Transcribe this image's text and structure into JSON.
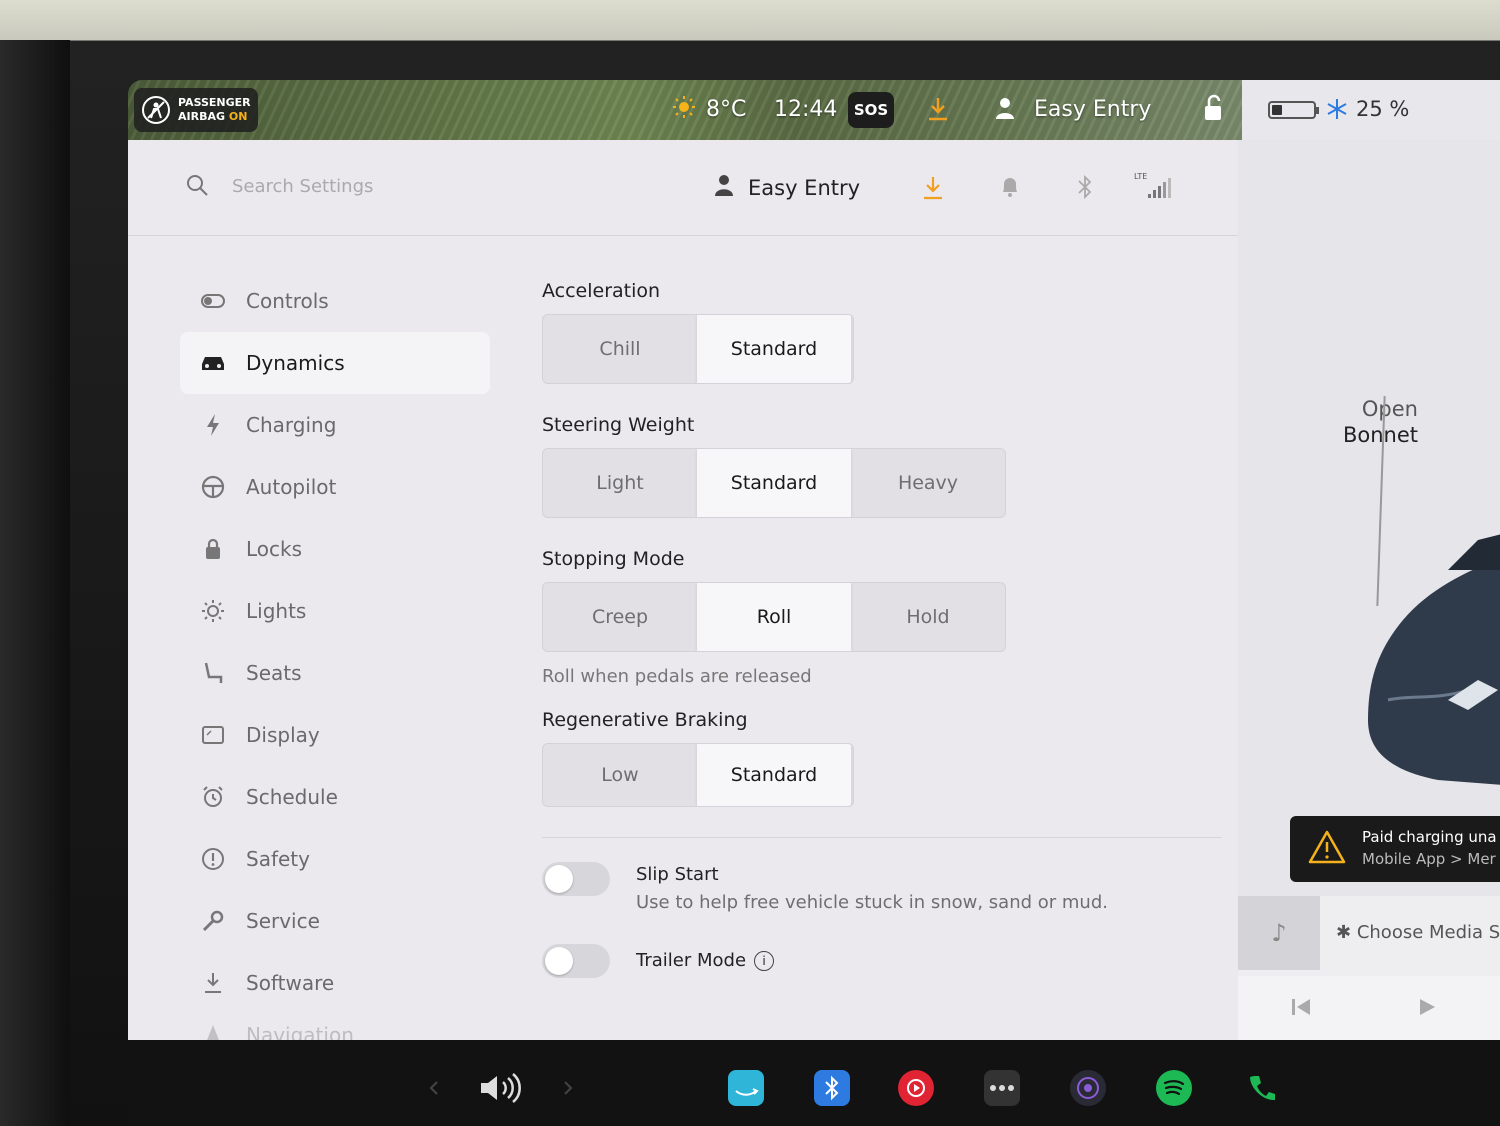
{
  "status_bar": {
    "airbag_line1": "PASSENGER",
    "airbag_line2": "AIRBAG",
    "airbag_state": "ON",
    "temperature": "8°C",
    "time": "12:44",
    "sos": "SOS",
    "profile": "Easy Entry",
    "battery_percent": "25 %",
    "battery_level": 0.25
  },
  "search": {
    "placeholder": "Search Settings"
  },
  "topbar": {
    "profile_name": "Easy Entry",
    "network": "LTE"
  },
  "sidebar": {
    "items": [
      {
        "label": "Controls",
        "icon": "toggle-icon"
      },
      {
        "label": "Dynamics",
        "icon": "car-icon",
        "active": true
      },
      {
        "label": "Charging",
        "icon": "bolt-icon"
      },
      {
        "label": "Autopilot",
        "icon": "steering-wheel-icon"
      },
      {
        "label": "Locks",
        "icon": "lock-icon"
      },
      {
        "label": "Lights",
        "icon": "sun-icon"
      },
      {
        "label": "Seats",
        "icon": "seat-icon"
      },
      {
        "label": "Display",
        "icon": "display-icon"
      },
      {
        "label": "Schedule",
        "icon": "alarm-icon"
      },
      {
        "label": "Safety",
        "icon": "alert-circle-icon"
      },
      {
        "label": "Service",
        "icon": "wrench-icon"
      },
      {
        "label": "Software",
        "icon": "download-icon"
      },
      {
        "label": "Navigation",
        "icon": "navigation-icon"
      }
    ]
  },
  "dynamics": {
    "acceleration": {
      "title": "Acceleration",
      "options": [
        "Chill",
        "Standard"
      ],
      "selected": "Standard"
    },
    "steering_weight": {
      "title": "Steering Weight",
      "options": [
        "Light",
        "Standard",
        "Heavy"
      ],
      "selected": "Standard"
    },
    "stopping_mode": {
      "title": "Stopping Mode",
      "options": [
        "Creep",
        "Roll",
        "Hold"
      ],
      "selected": "Roll",
      "help": "Roll when pedals are released"
    },
    "regenerative_braking": {
      "title": "Regenerative Braking",
      "options": [
        "Low",
        "Standard"
      ],
      "selected": "Standard"
    },
    "slip_start": {
      "label": "Slip Start",
      "description": "Use to help free vehicle stuck in snow, sand or mud.",
      "enabled": false
    },
    "trailer_mode": {
      "label": "Trailer Mode",
      "enabled": false
    }
  },
  "car_panel": {
    "open_label": "Open",
    "bonnet_label": "Bonnet",
    "alert_line1": "Paid charging una",
    "alert_line2": "Mobile App > Mer",
    "media_choose": "Choose Media So"
  },
  "colors": {
    "accent_orange": "#f0a020",
    "airbag_on": "#f5b21a",
    "snowflake": "#2d7be0"
  }
}
